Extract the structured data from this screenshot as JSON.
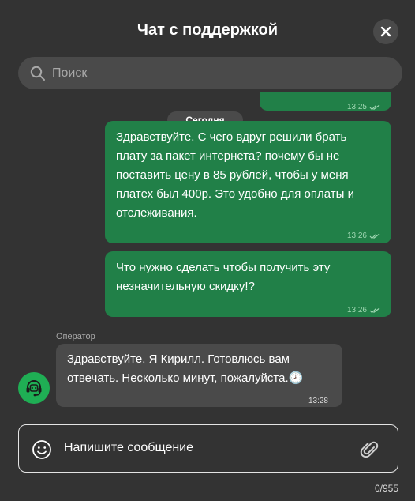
{
  "header": {
    "title": "Чат с поддержкой",
    "close_icon": "close-icon"
  },
  "search": {
    "placeholder": "Поиск",
    "icon": "search-icon"
  },
  "messages": {
    "date_divider": "Сегодня",
    "outgoing": [
      {
        "text": "",
        "time": "13:25",
        "status_icon": "double-check-icon"
      },
      {
        "text": "Здравствуйте. С чего вдруг решили брать\nплату за пакет интернета? почему бы не\nпоставить цену в 85 рублей, чтобы у меня\nплатех был 400р. Это удобно для оплаты и\nотслеживания.",
        "time": "13:26",
        "status_icon": "double-check-icon"
      },
      {
        "text": "Что нужно сделать чтобы получить эту\nнезначительную скидку!?",
        "time": "13:26",
        "status_icon": "double-check-icon"
      }
    ],
    "operator": {
      "label": "Оператор",
      "avatar_icon": "operator-headset-icon",
      "text": "Здравствуйте. Я Кирилл. Готовлюсь вам\nотвечать. Несколько минут, пожалуйста.",
      "emoji": "🕗",
      "time": "13:28"
    }
  },
  "composer": {
    "placeholder": "Напишите сообщение",
    "emoji_icon": "smiley-icon",
    "attach_icon": "paperclip-icon",
    "counter": "0/955"
  },
  "colors": {
    "background": "#333333",
    "outgoing_bubble": "#218048",
    "incoming_bubble": "#4a4a4a",
    "avatar": "#1fae54"
  }
}
